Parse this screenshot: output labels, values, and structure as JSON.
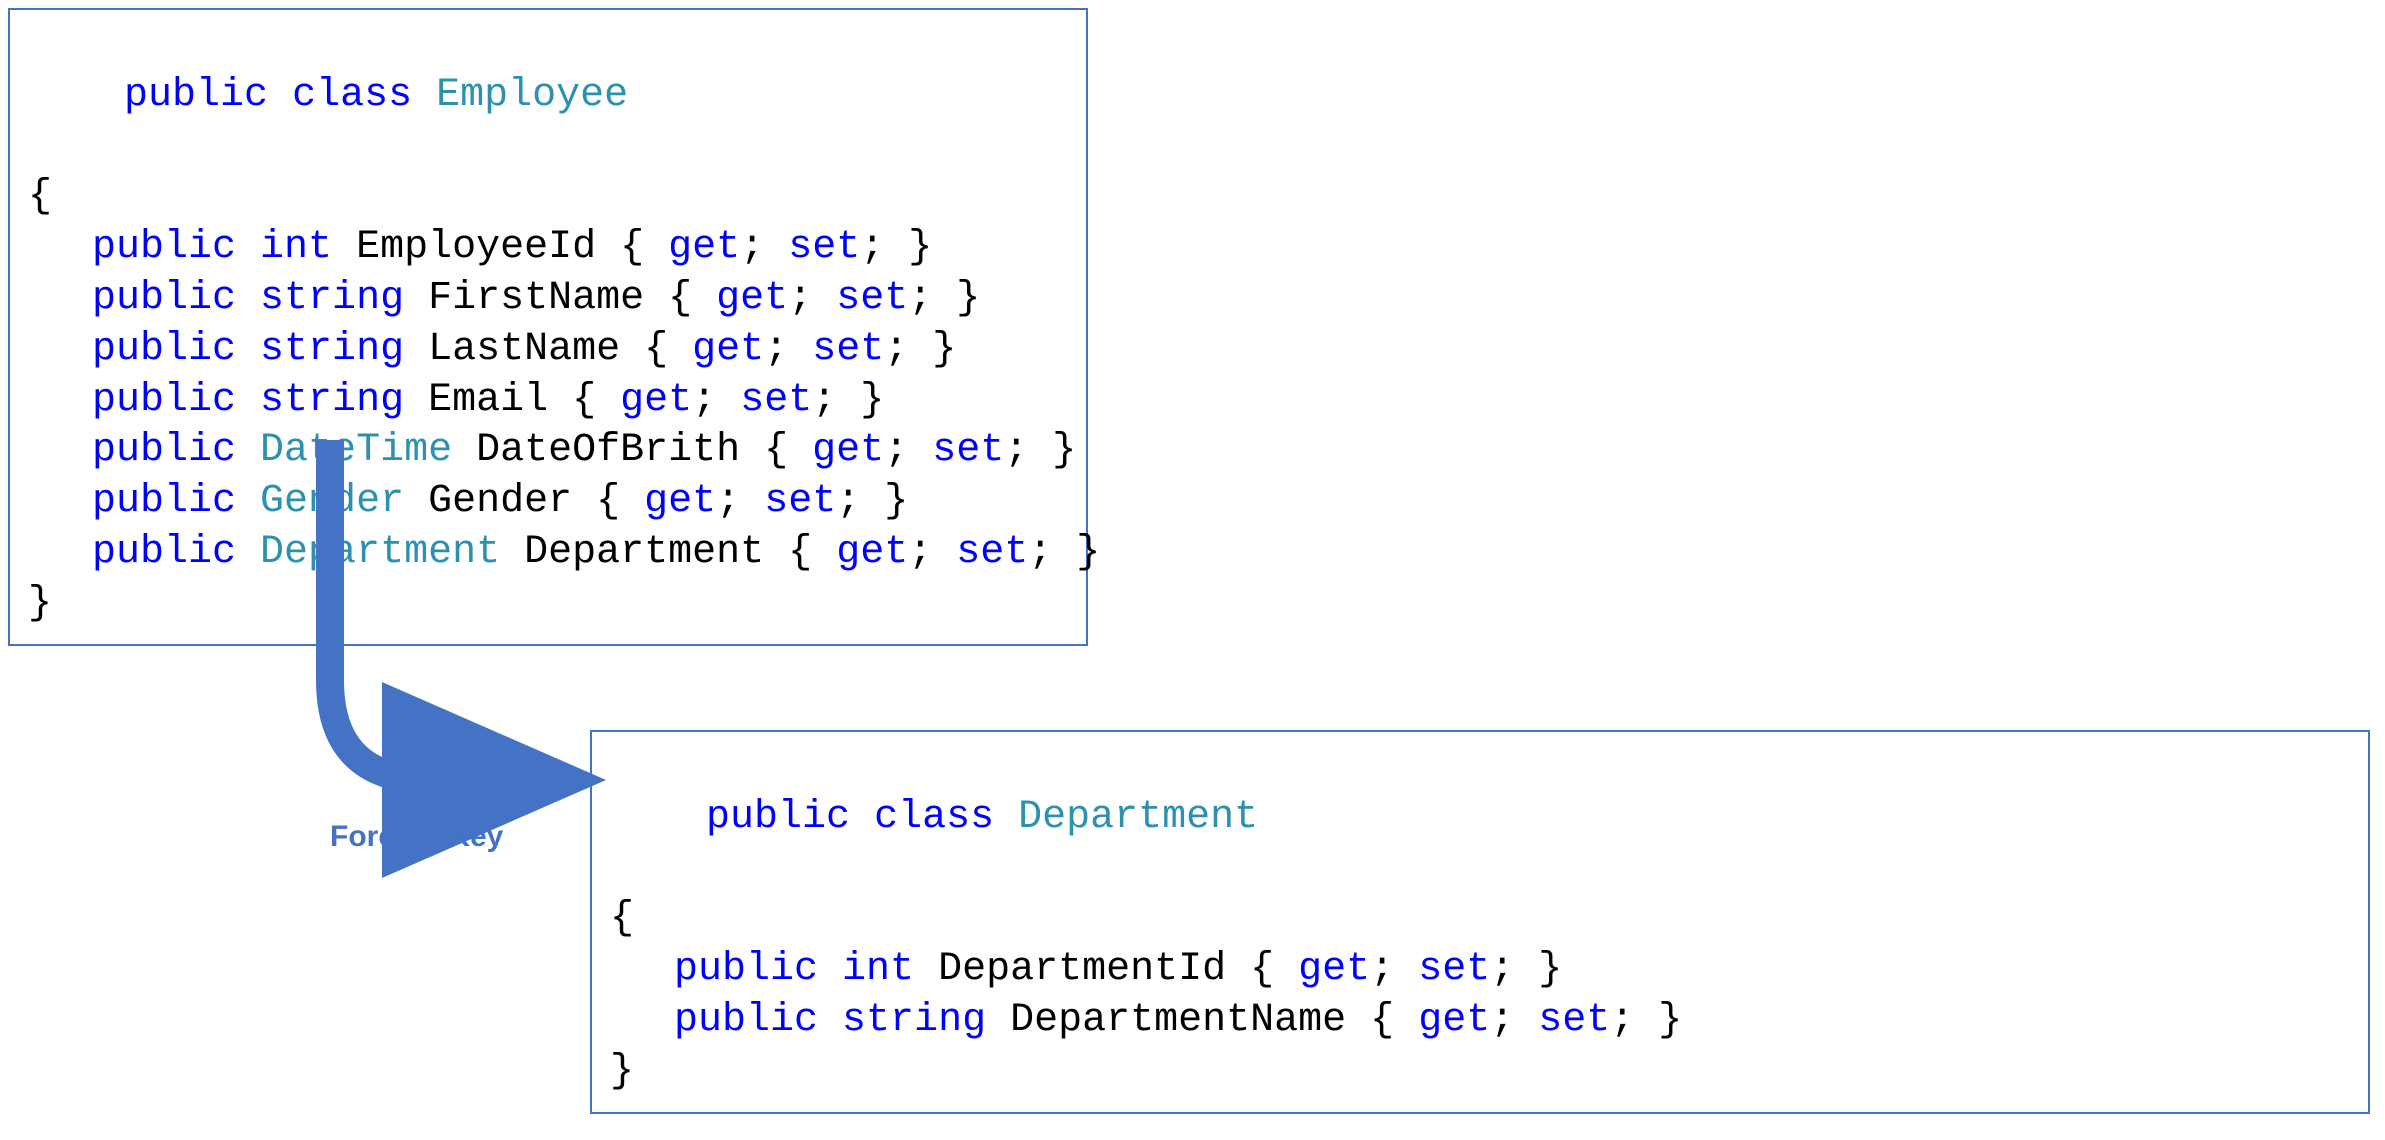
{
  "colors": {
    "keyword": "#0000ff",
    "type": "#2b91af",
    "text": "#000000",
    "border": "#4472C4",
    "arrow": "#4472C4"
  },
  "arrow_label": "Foreign Key",
  "employee": {
    "decl_public": "public",
    "decl_class": "class",
    "decl_name": "Employee",
    "open_brace": "{",
    "close_brace": "}",
    "props": [
      {
        "mod": "public",
        "type": "int",
        "type_is_usertype": false,
        "name": "EmployeeId",
        "get": "get",
        "set": "set"
      },
      {
        "mod": "public",
        "type": "string",
        "type_is_usertype": false,
        "name": "FirstName",
        "get": "get",
        "set": "set"
      },
      {
        "mod": "public",
        "type": "string",
        "type_is_usertype": false,
        "name": "LastName",
        "get": "get",
        "set": "set"
      },
      {
        "mod": "public",
        "type": "string",
        "type_is_usertype": false,
        "name": "Email",
        "get": "get",
        "set": "set"
      },
      {
        "mod": "public",
        "type": "DateTime",
        "type_is_usertype": true,
        "name": "DateOfBrith",
        "get": "get",
        "set": "set"
      },
      {
        "mod": "public",
        "type": "Gender",
        "type_is_usertype": true,
        "name": "Gender",
        "get": "get",
        "set": "set"
      },
      {
        "mod": "public",
        "type": "Department",
        "type_is_usertype": true,
        "name": "Department",
        "get": "get",
        "set": "set"
      }
    ]
  },
  "department": {
    "decl_public": "public",
    "decl_class": "class",
    "decl_name": "Department",
    "open_brace": "{",
    "close_brace": "}",
    "props": [
      {
        "mod": "public",
        "type": "int",
        "type_is_usertype": false,
        "name": "DepartmentId",
        "get": "get",
        "set": "set"
      },
      {
        "mod": "public",
        "type": "string",
        "type_is_usertype": false,
        "name": "DepartmentName",
        "get": "get",
        "set": "set"
      }
    ]
  }
}
